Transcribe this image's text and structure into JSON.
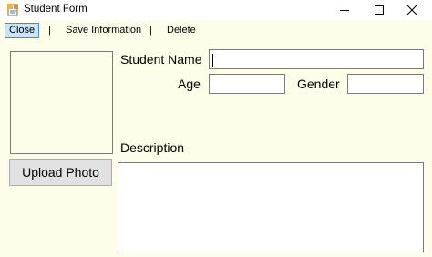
{
  "window": {
    "title": "Student Form",
    "icon": "form-app-icon",
    "controls": [
      "minimize-icon",
      "maximize-icon",
      "close-icon"
    ]
  },
  "menu": {
    "close": "Close",
    "sep1": "|",
    "save": "Save Information",
    "sep2": "|",
    "delete": "Delete"
  },
  "form": {
    "upload_button": "Upload Photo",
    "student_name_label": "Student Name",
    "student_name_value": "",
    "age_label": "Age",
    "age_value": "",
    "gender_label": "Gender",
    "gender_value": "",
    "description_label": "Description",
    "description_value": ""
  },
  "colors": {
    "background": "#fdfde9",
    "menu_selected": "#cce4f7",
    "menu_selected_border": "#3f8fd6",
    "button_face": "#e1e1e1"
  }
}
